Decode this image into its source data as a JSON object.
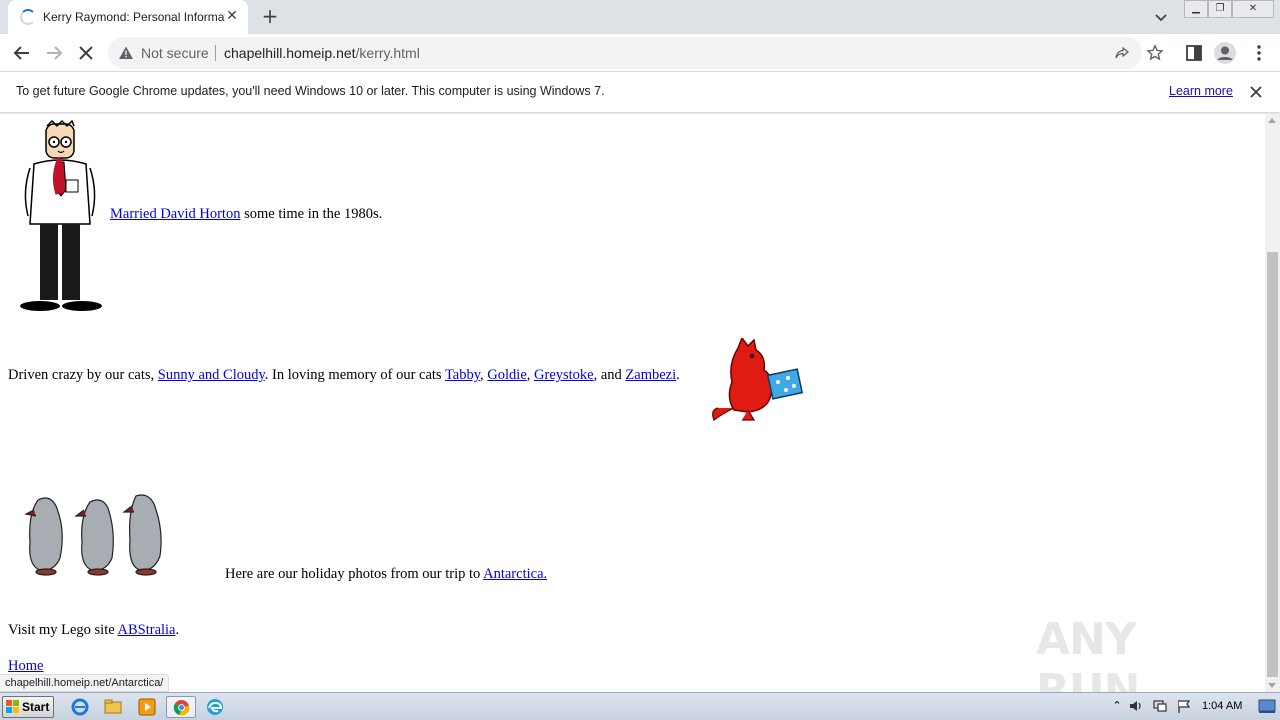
{
  "browser": {
    "tab_title": "Kerry Raymond: Personal Information",
    "security_label": "Not secure",
    "url_host": "chapelhill.homeip.net",
    "url_path": "/kerry.html"
  },
  "infobar": {
    "message": "To get future Google Chrome updates, you'll need Windows 10 or later. This computer is using Windows 7.",
    "learn_more": "Learn more"
  },
  "content": {
    "married": {
      "link": "Married David Horton",
      "rest": " some time in the 1980s."
    },
    "cats": {
      "prefix": "Driven crazy by our cats, ",
      "link_sunny": "Sunny and Cloudy",
      "mid": ". In loving memory of our cats ",
      "link_tabby": "Tabby",
      "sep1": ", ",
      "link_goldie": "Goldie",
      "sep2": ", ",
      "link_greystoke": "Greystoke",
      "sep3": ", and ",
      "link_zambezi": "Zambezi",
      "end": "."
    },
    "holiday": {
      "prefix": "Here are our holiday photos from our trip to ",
      "link": "Antarctica."
    },
    "lego": {
      "prefix": "Visit my Lego site ",
      "link": "ABStralia",
      "end": "."
    },
    "home_link": "Home"
  },
  "status_url": "chapelhill.homeip.net/Antarctica/",
  "watermark": "ANY RUN",
  "taskbar": {
    "start_label": "Start",
    "clock": "1:04 AM"
  }
}
